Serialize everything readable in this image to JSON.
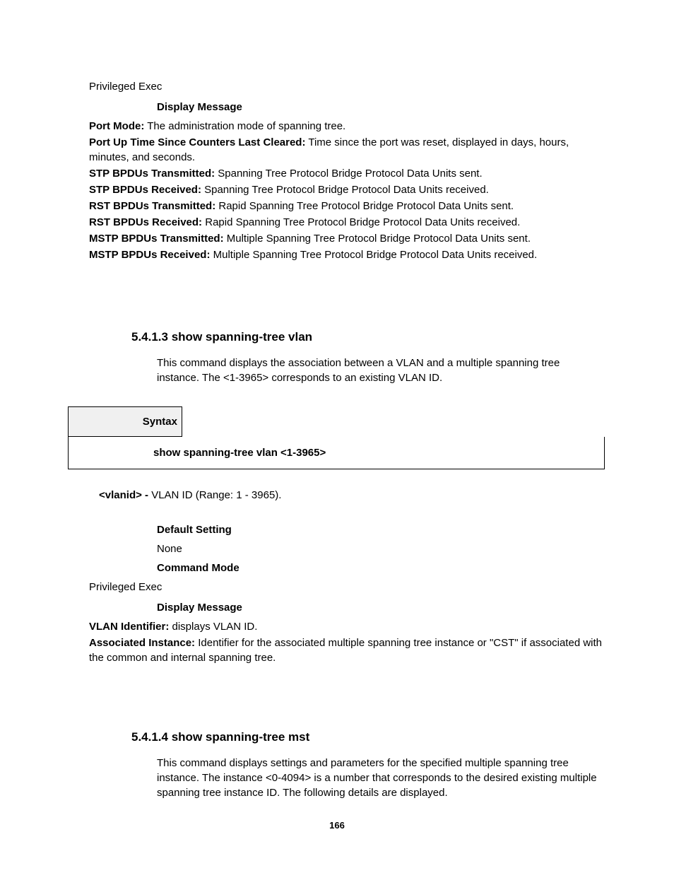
{
  "top": {
    "priv_exec": "Privileged Exec",
    "display_message": "Display Message",
    "defs": [
      {
        "term": "Port Mode:",
        "desc": " The administration mode of spanning tree."
      },
      {
        "term": "Port Up Time Since Counters Last Cleared:",
        "desc": " Time since the port was reset, displayed in days, hours, minutes, and seconds."
      },
      {
        "term": "STP BPDUs Transmitted:",
        "desc": " Spanning Tree Protocol Bridge Protocol Data Units sent."
      },
      {
        "term": "STP BPDUs Received:",
        "desc": " Spanning Tree Protocol Bridge Protocol Data Units received."
      },
      {
        "term": "RST BPDUs Transmitted:",
        "desc": " Rapid Spanning Tree Protocol Bridge Protocol Data Units sent."
      },
      {
        "term": "RST BPDUs Received:",
        "desc": " Rapid Spanning Tree Protocol Bridge Protocol Data Units received."
      },
      {
        "term": "MSTP BPDUs Transmitted:",
        "desc": " Multiple Spanning Tree Protocol Bridge Protocol Data Units sent."
      },
      {
        "term": "MSTP BPDUs Received:",
        "desc": " Multiple Spanning Tree Protocol Bridge Protocol Data Units received."
      }
    ]
  },
  "sec1": {
    "number": "5.4.1.3 ",
    "title": "show spanning-tree vlan",
    "desc": "This command displays the association between a VLAN and a multiple spanning tree instance. The <1-3965> corresponds to an existing VLAN ID.",
    "syntax_label": "Syntax",
    "syntax_cmd": "show spanning-tree vlan <1-3965>",
    "param_term": "<vlanid> - ",
    "param_desc": "VLAN ID (Range: 1 - 3965).",
    "default_setting_h": "Default Setting",
    "default_setting_v": "None",
    "command_mode_h": "Command Mode",
    "command_mode_v": "Privileged Exec",
    "display_message_h": "Display Message",
    "defs": [
      {
        "term": "VLAN Identifier:",
        "desc": " displays VLAN ID."
      },
      {
        "term": "Associated Instance:",
        "desc": " Identifier for the associated multiple spanning tree instance or \"CST\" if associated with the common and internal spanning tree."
      }
    ]
  },
  "sec2": {
    "number": "5.4.1.4 ",
    "title": "show spanning-tree mst",
    "desc": "This command displays settings and parameters for the specified multiple spanning tree instance. The instance <0-4094> is a number that corresponds to the desired existing multiple spanning tree instance ID. The following details are displayed."
  },
  "page_number": "166"
}
